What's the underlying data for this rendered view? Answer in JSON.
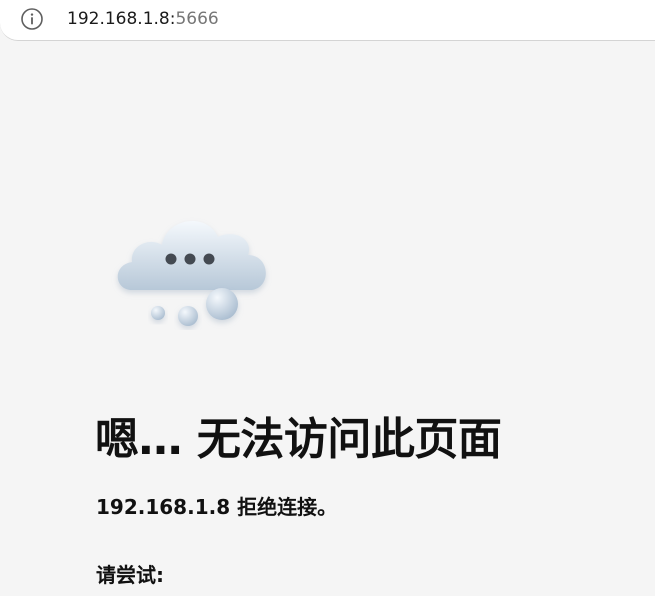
{
  "address_bar": {
    "host": "192.168.1.8:",
    "port": "5666",
    "info_icon": "info-icon"
  },
  "illustration": {
    "icon": "cloud-thinking-icon"
  },
  "error": {
    "title": "嗯… 无法访问此页面",
    "message": "192.168.1.8 拒绝连接。",
    "try_label": "请尝试:"
  },
  "colors": {
    "background": "#f5f5f5",
    "text": "#111111",
    "url_muted": "#767676",
    "cloud": "#c8d6e3"
  }
}
